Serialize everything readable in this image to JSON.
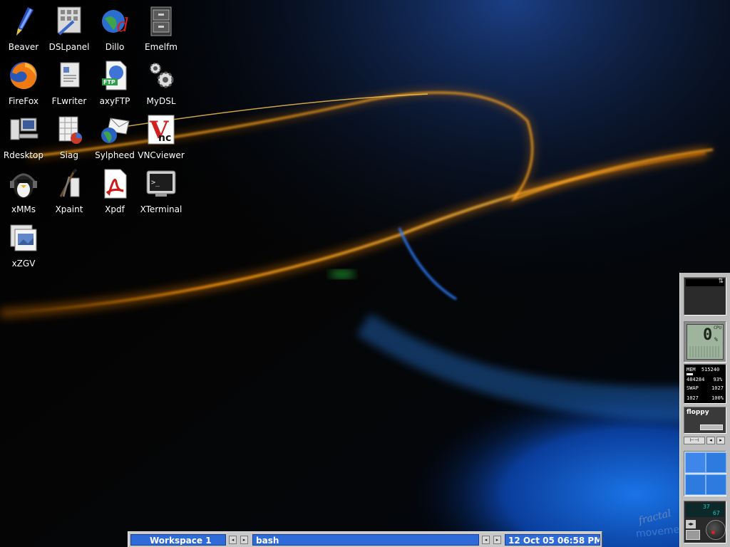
{
  "desktop": {
    "icons": [
      {
        "label": "Beaver"
      },
      {
        "label": "DSLpanel"
      },
      {
        "label": "Dillo"
      },
      {
        "label": "Emelfm"
      },
      {
        "label": "FireFox"
      },
      {
        "label": "FLwriter"
      },
      {
        "label": "axyFTP"
      },
      {
        "label": "MyDSL"
      },
      {
        "label": "Rdesktop"
      },
      {
        "label": "Siag"
      },
      {
        "label": "Sylpheed"
      },
      {
        "label": "VNCviewer"
      },
      {
        "label": "xMMs"
      },
      {
        "label": "Xpaint"
      },
      {
        "label": "Xpdf"
      },
      {
        "label": "XTerminal"
      },
      {
        "label": "xZGV"
      }
    ],
    "watermark": "fractal movement"
  },
  "taskbar": {
    "workspace": "Workspace 1",
    "task": "bash",
    "clock": "12 Oct 05 06:58 PM"
  },
  "dock": {
    "cpu_reading": "0",
    "cpu_unit": "%",
    "cpu_label": "CPU",
    "mem_label": "MEM",
    "mem_total": "515240",
    "mem_used": "484284",
    "mem_pct": "93%",
    "swap_label": "SWAP",
    "swap_total": "1027",
    "swap_used": "1027",
    "swap_pct": "100%",
    "floppy_label": "floppy",
    "mixer_left": "37",
    "mixer_right": "67"
  },
  "colors": {
    "accent_blue": "#2f6bd8",
    "workspace_blue": "#2e7be0",
    "lcd_green": "#9fb49c"
  }
}
